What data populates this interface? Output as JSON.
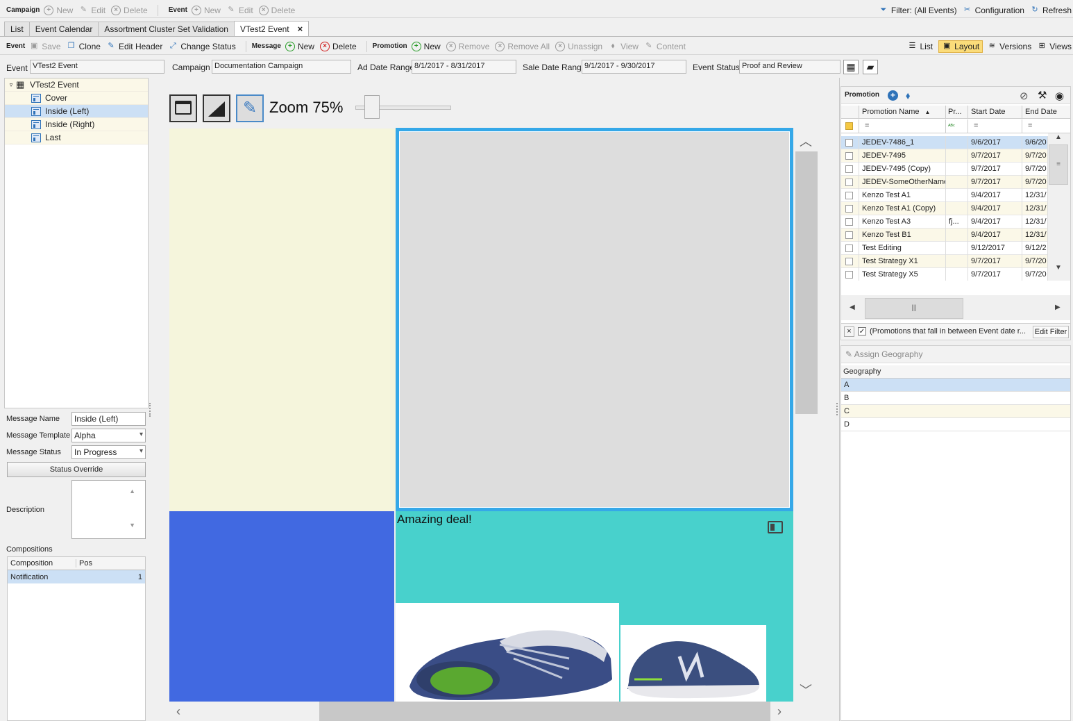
{
  "top_toolbar": {
    "campaign_group": "Campaign",
    "campaign_new": "New",
    "campaign_edit": "Edit",
    "campaign_delete": "Delete",
    "event_group": "Event",
    "event_new": "New",
    "event_edit": "Edit",
    "event_delete": "Delete",
    "filter": "Filter: (All Events)",
    "configuration": "Configuration",
    "refresh": "Refresh"
  },
  "tabs": [
    {
      "label": "List"
    },
    {
      "label": "Event Calendar"
    },
    {
      "label": "Assortment Cluster Set Validation"
    },
    {
      "label": "VTest2 Event"
    }
  ],
  "event_toolbar": {
    "event_group": "Event",
    "save": "Save",
    "clone": "Clone",
    "edit_header": "Edit Header",
    "change_status": "Change Status",
    "message_group": "Message",
    "message_new": "New",
    "message_delete": "Delete",
    "promotion_group": "Promotion",
    "promotion_new": "New",
    "remove": "Remove",
    "remove_all": "Remove All",
    "unassign": "Unassign",
    "view": "View",
    "content": "Content",
    "list": "List",
    "layout": "Layout",
    "versions": "Versions",
    "views": "Views"
  },
  "header_fields": {
    "event_label": "Event",
    "event_value": "VTest2 Event",
    "campaign_label": "Campaign",
    "campaign_value": "Documentation Campaign",
    "ad_date_label": "Ad Date Range",
    "ad_date_value": "8/1/2017 - 8/31/2017",
    "sale_date_label": "Sale Date Range",
    "sale_date_value": "9/1/2017 - 9/30/2017",
    "status_label": "Event Status",
    "status_value": "Proof and Review"
  },
  "tree": {
    "root": "VTest2 Event",
    "pages": [
      {
        "label": "Cover"
      },
      {
        "label": "Inside (Left)"
      },
      {
        "label": "Inside (Right)"
      },
      {
        "label": "Last"
      }
    ]
  },
  "message_form": {
    "name_label": "Message Name",
    "name_value": "Inside (Left)",
    "template_label": "Message Template",
    "template_value": "Alpha",
    "status_label": "Message Status",
    "status_value": "In Progress",
    "status_override": "Status Override",
    "description_label": "Description",
    "compositions_label": "Compositions",
    "comp_col1": "Composition",
    "comp_col2": "Pos",
    "comp_row_name": "Notification",
    "comp_row_pos": "1"
  },
  "canvas": {
    "zoom_label": "Zoom 75%",
    "zoom_percent": 75,
    "banner_text": "Amazing deal!"
  },
  "promotion_panel": {
    "title": "Promotion",
    "col_name": "Promotion Name",
    "col_pr": "Pr...",
    "col_start": "Start Date",
    "col_end": "End Date",
    "filter_symbol": "=",
    "rows": [
      {
        "name": "JEDEV-7486_1",
        "pr": "",
        "start": "9/6/2017",
        "end": "9/6/20"
      },
      {
        "name": "JEDEV-7495",
        "pr": "",
        "start": "9/7/2017",
        "end": "9/7/20"
      },
      {
        "name": "JEDEV-7495 (Copy)",
        "pr": "",
        "start": "9/7/2017",
        "end": "9/7/20"
      },
      {
        "name": "JEDEV-SomeOtherName",
        "pr": "",
        "start": "9/7/2017",
        "end": "9/7/20"
      },
      {
        "name": "Kenzo Test A1",
        "pr": "",
        "start": "9/4/2017",
        "end": "12/31/"
      },
      {
        "name": "Kenzo Test A1 (Copy)",
        "pr": "",
        "start": "9/4/2017",
        "end": "12/31/"
      },
      {
        "name": "Kenzo Test A3",
        "pr": "fj...",
        "start": "9/4/2017",
        "end": "12/31/"
      },
      {
        "name": "Kenzo Test B1",
        "pr": "",
        "start": "9/4/2017",
        "end": "12/31/"
      },
      {
        "name": "Test Editing",
        "pr": "",
        "start": "9/12/2017",
        "end": "9/12/2"
      },
      {
        "name": "Test Strategy X1",
        "pr": "",
        "start": "9/7/2017",
        "end": "9/7/20"
      },
      {
        "name": "Test Strategy X5",
        "pr": "",
        "start": "9/7/2017",
        "end": "9/7/20"
      }
    ],
    "filter_text": "(Promotions that fall in between Event date r...",
    "edit_filter": "Edit Filter"
  },
  "geography_panel": {
    "assign": "Assign Geography",
    "col": "Geography",
    "rows": [
      "A",
      "B",
      "C",
      "D"
    ]
  },
  "colors": {
    "accent_blue": "#35a8e8",
    "block_blue": "#4169e1",
    "block_teal": "#48d1cc",
    "block_cream": "#f5f5dc",
    "selection": "#cce0f5"
  }
}
